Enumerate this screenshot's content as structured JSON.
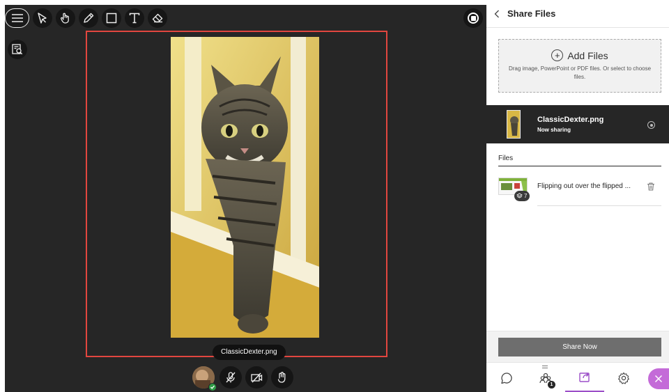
{
  "stage": {
    "toolbar": {
      "menu_icon": "hamburger-icon",
      "tools": [
        "select-arrow-icon",
        "pointer-hand-icon",
        "pencil-icon",
        "rectangle-icon",
        "text-icon",
        "eraser-icon"
      ]
    },
    "shared_file_caption": "ClassicDexter.png",
    "frame_color": "#e2463f",
    "bottom_controls": [
      "avatar",
      "microphone-off-icon",
      "camera-off-icon",
      "raise-hand-icon"
    ]
  },
  "panel": {
    "title": "Share Files",
    "add_files_label": "Add Files",
    "dropzone_hint": "Drag image, PowerPoint or PDF files. Or select to choose files.",
    "now_sharing": {
      "name": "ClassicDexter.png",
      "status": "Now sharing"
    },
    "files_heading": "Files",
    "files": [
      {
        "name": "Flipping out over the flipped ...",
        "pages": "7"
      }
    ],
    "share_now_label": "Share Now",
    "tabs": [
      "chat-icon",
      "attendees-icon",
      "share-content-icon",
      "settings-icon"
    ],
    "attendee_badge": "1",
    "accent_color": "#9b4ec8"
  }
}
